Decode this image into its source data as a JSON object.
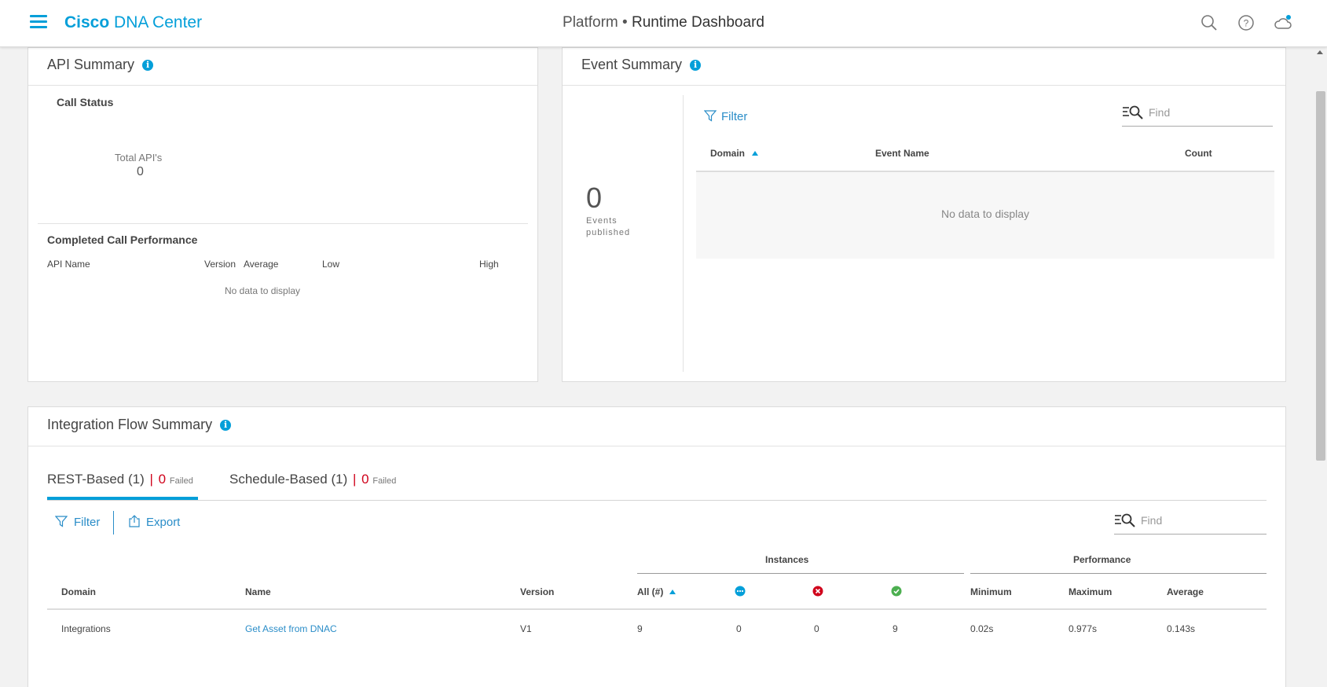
{
  "header": {
    "brand_bold": "Cisco",
    "brand_rest": "DNA Center",
    "section": "Platform",
    "separator": "•",
    "page": "Runtime Dashboard"
  },
  "api_summary": {
    "title": "API Summary",
    "call_status": "Call Status",
    "total_label": "Total API's",
    "total_value": "0",
    "completed_title": "Completed Call Performance",
    "columns": [
      "API Name",
      "Version",
      "Average",
      "Low",
      "High"
    ],
    "empty": "No data to display"
  },
  "event_summary": {
    "title": "Event Summary",
    "count": "0",
    "events_label_1": "Events",
    "events_label_2": "published",
    "filter": "Filter",
    "find_placeholder": "Find",
    "columns": [
      "Domain",
      "Event Name",
      "Count"
    ],
    "empty": "No data to display"
  },
  "integration": {
    "title": "Integration Flow Summary",
    "tabs": [
      {
        "label": "REST-Based (1)",
        "sep": "|",
        "failed_count": "0",
        "failed_label": "Failed"
      },
      {
        "label": "Schedule-Based (1)",
        "sep": "|",
        "failed_count": "0",
        "failed_label": "Failed"
      }
    ],
    "filter": "Filter",
    "export": "Export",
    "find_placeholder": "Find",
    "group_instances": "Instances",
    "group_performance": "Performance",
    "columns": [
      "Domain",
      "Name",
      "Version",
      "All (#)",
      "Minimum",
      "Maximum",
      "Average"
    ],
    "rows": [
      {
        "domain": "Integrations",
        "name": "Get Asset from DNAC",
        "version": "V1",
        "all": "9",
        "in_progress": "0",
        "failed": "0",
        "success": "9",
        "min": "0.02s",
        "max": "0.977s",
        "avg": "0.143s"
      }
    ]
  },
  "colors": {
    "accent": "#049fd9",
    "failed": "#d0021b",
    "success": "#4caf50"
  }
}
